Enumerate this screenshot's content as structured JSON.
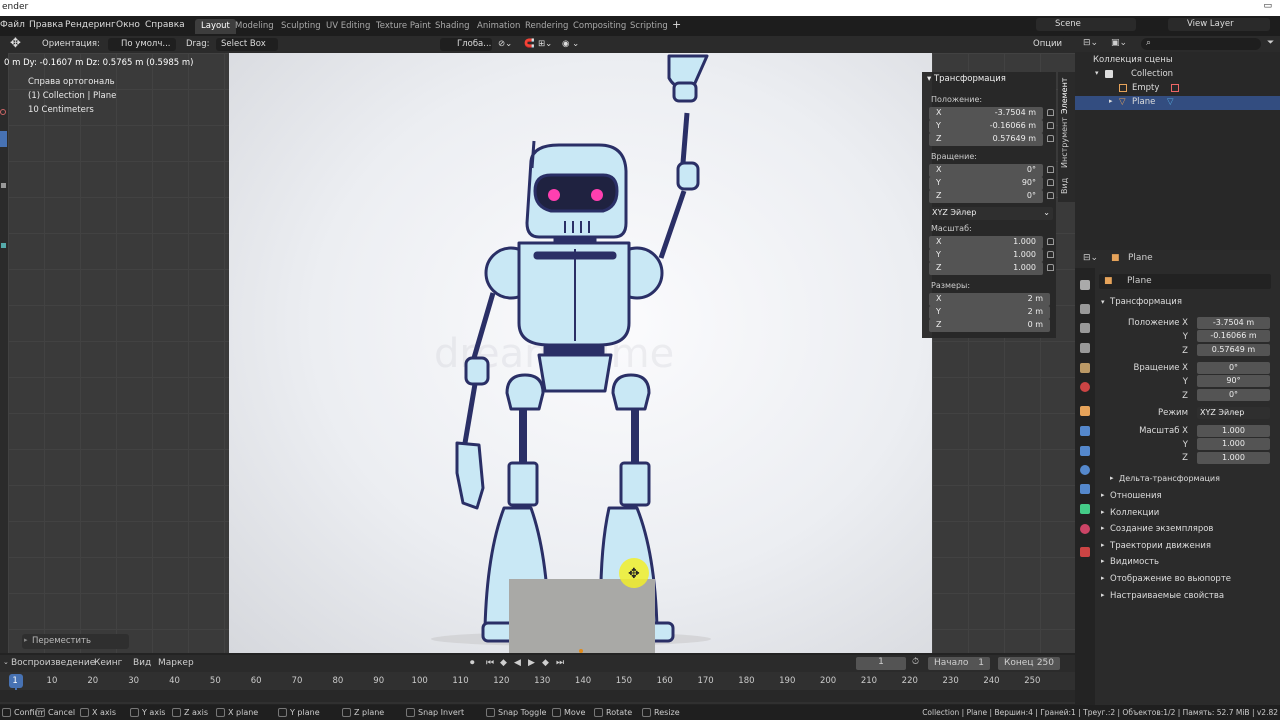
{
  "title_bar": {
    "app": "ender"
  },
  "menu": {
    "items": [
      "Файл",
      "Правка",
      "Рендеринг",
      "Окно",
      "Справка"
    ],
    "tabs": [
      "Layout",
      "Modeling",
      "Sculpting",
      "UV Editing",
      "Texture Paint",
      "Shading",
      "Animation",
      "Rendering",
      "Compositing",
      "Scripting"
    ],
    "add": "+",
    "scene": "Scene",
    "view_layer": "View Layer"
  },
  "header": {
    "orientation_label": "Ориентация:",
    "orientation_value": "По умолч...",
    "drag_label": "Drag:",
    "drag_value": "Select Box",
    "global": "Глоба...",
    "options": "Опции"
  },
  "viewport": {
    "delta": "0 m  Dy: -0.1607 m  Dz: 0.5765 m (0.5985 m)",
    "view_name": "Справа ортогональ",
    "collection": "(1) Collection | Plane",
    "scale": "10 Centimeters",
    "watermark": "dreamstime",
    "operator_panel": "Переместить"
  },
  "n_panel": {
    "title": "Трансформация",
    "location_label": "Положение:",
    "location": [
      {
        "axis": "X",
        "value": "-3.7504 m"
      },
      {
        "axis": "Y",
        "value": "-0.16066 m"
      },
      {
        "axis": "Z",
        "value": "0.57649 m"
      }
    ],
    "rotation_label": "Вращение:",
    "rotation": [
      {
        "axis": "X",
        "value": "0°"
      },
      {
        "axis": "Y",
        "value": "90°"
      },
      {
        "axis": "Z",
        "value": "0°"
      }
    ],
    "mode": "XYZ Эйлер",
    "scale_label": "Масштаб:",
    "scale": [
      {
        "axis": "X",
        "value": "1.000"
      },
      {
        "axis": "Y",
        "value": "1.000"
      },
      {
        "axis": "Z",
        "value": "1.000"
      }
    ],
    "dims_label": "Размеры:",
    "dims": [
      {
        "axis": "X",
        "value": "2 m"
      },
      {
        "axis": "Y",
        "value": "2 m"
      },
      {
        "axis": "Z",
        "value": "0 m"
      }
    ],
    "tabs": [
      "Элемент",
      "Инструмент",
      "Вид"
    ]
  },
  "outliner": {
    "root": "Коллекция сцены",
    "collection": "Collection",
    "items": [
      "Empty",
      "Plane"
    ]
  },
  "properties": {
    "object": "Plane",
    "object_name": "Plane",
    "section": "Трансформация",
    "location_label": "Положение X",
    "location": [
      "-3.7504 m",
      "-0.16066 m",
      "0.57649 m"
    ],
    "rotation_label": "Вращение X",
    "rotation": [
      "0°",
      "90°",
      "0°"
    ],
    "mode_label": "Режим",
    "mode": "XYZ Эйлер",
    "scale_label": "Масштаб X",
    "scale": [
      "1.000",
      "1.000",
      "1.000"
    ],
    "axis_y": "Y",
    "axis_z": "Z",
    "delta": "Дельта-трансформация",
    "sections": [
      "Отношения",
      "Коллекции",
      "Создание экземпляров",
      "Траектории движения",
      "Видимость",
      "Отображение во вьюпорте",
      "Настраиваемые свойства"
    ]
  },
  "timeline": {
    "playback": "Воспроизведение",
    "keying": "Кеинг",
    "view": "Вид",
    "marker": "Маркер",
    "current": "1",
    "start_label": "Начало",
    "start": "1",
    "end_label": "Конец",
    "end": "250",
    "ticks": [
      "1",
      "10",
      "20",
      "30",
      "40",
      "50",
      "60",
      "70",
      "80",
      "90",
      "100",
      "110",
      "120",
      "130",
      "140",
      "150",
      "160",
      "170",
      "180",
      "190",
      "200",
      "210",
      "220",
      "230",
      "240",
      "250"
    ]
  },
  "status": {
    "items": [
      "Confirm",
      "Cancel",
      "X axis",
      "Y axis",
      "Z axis",
      "X plane",
      "Y plane",
      "Z plane",
      "Snap Invert",
      "Snap Toggle",
      "Move",
      "Rotate",
      "Resize"
    ],
    "right": "Collection | Plane | Вершин:4 | Граней:1 | Треуг.:2 | Объектов:1/2 | Память: 52.7 MiB | v2.82"
  },
  "colors": {
    "accent": "#4772b3",
    "robot_fill": "#c9e8f5",
    "robot_stroke": "#2a2f66",
    "eye": "#ff3fb0"
  }
}
